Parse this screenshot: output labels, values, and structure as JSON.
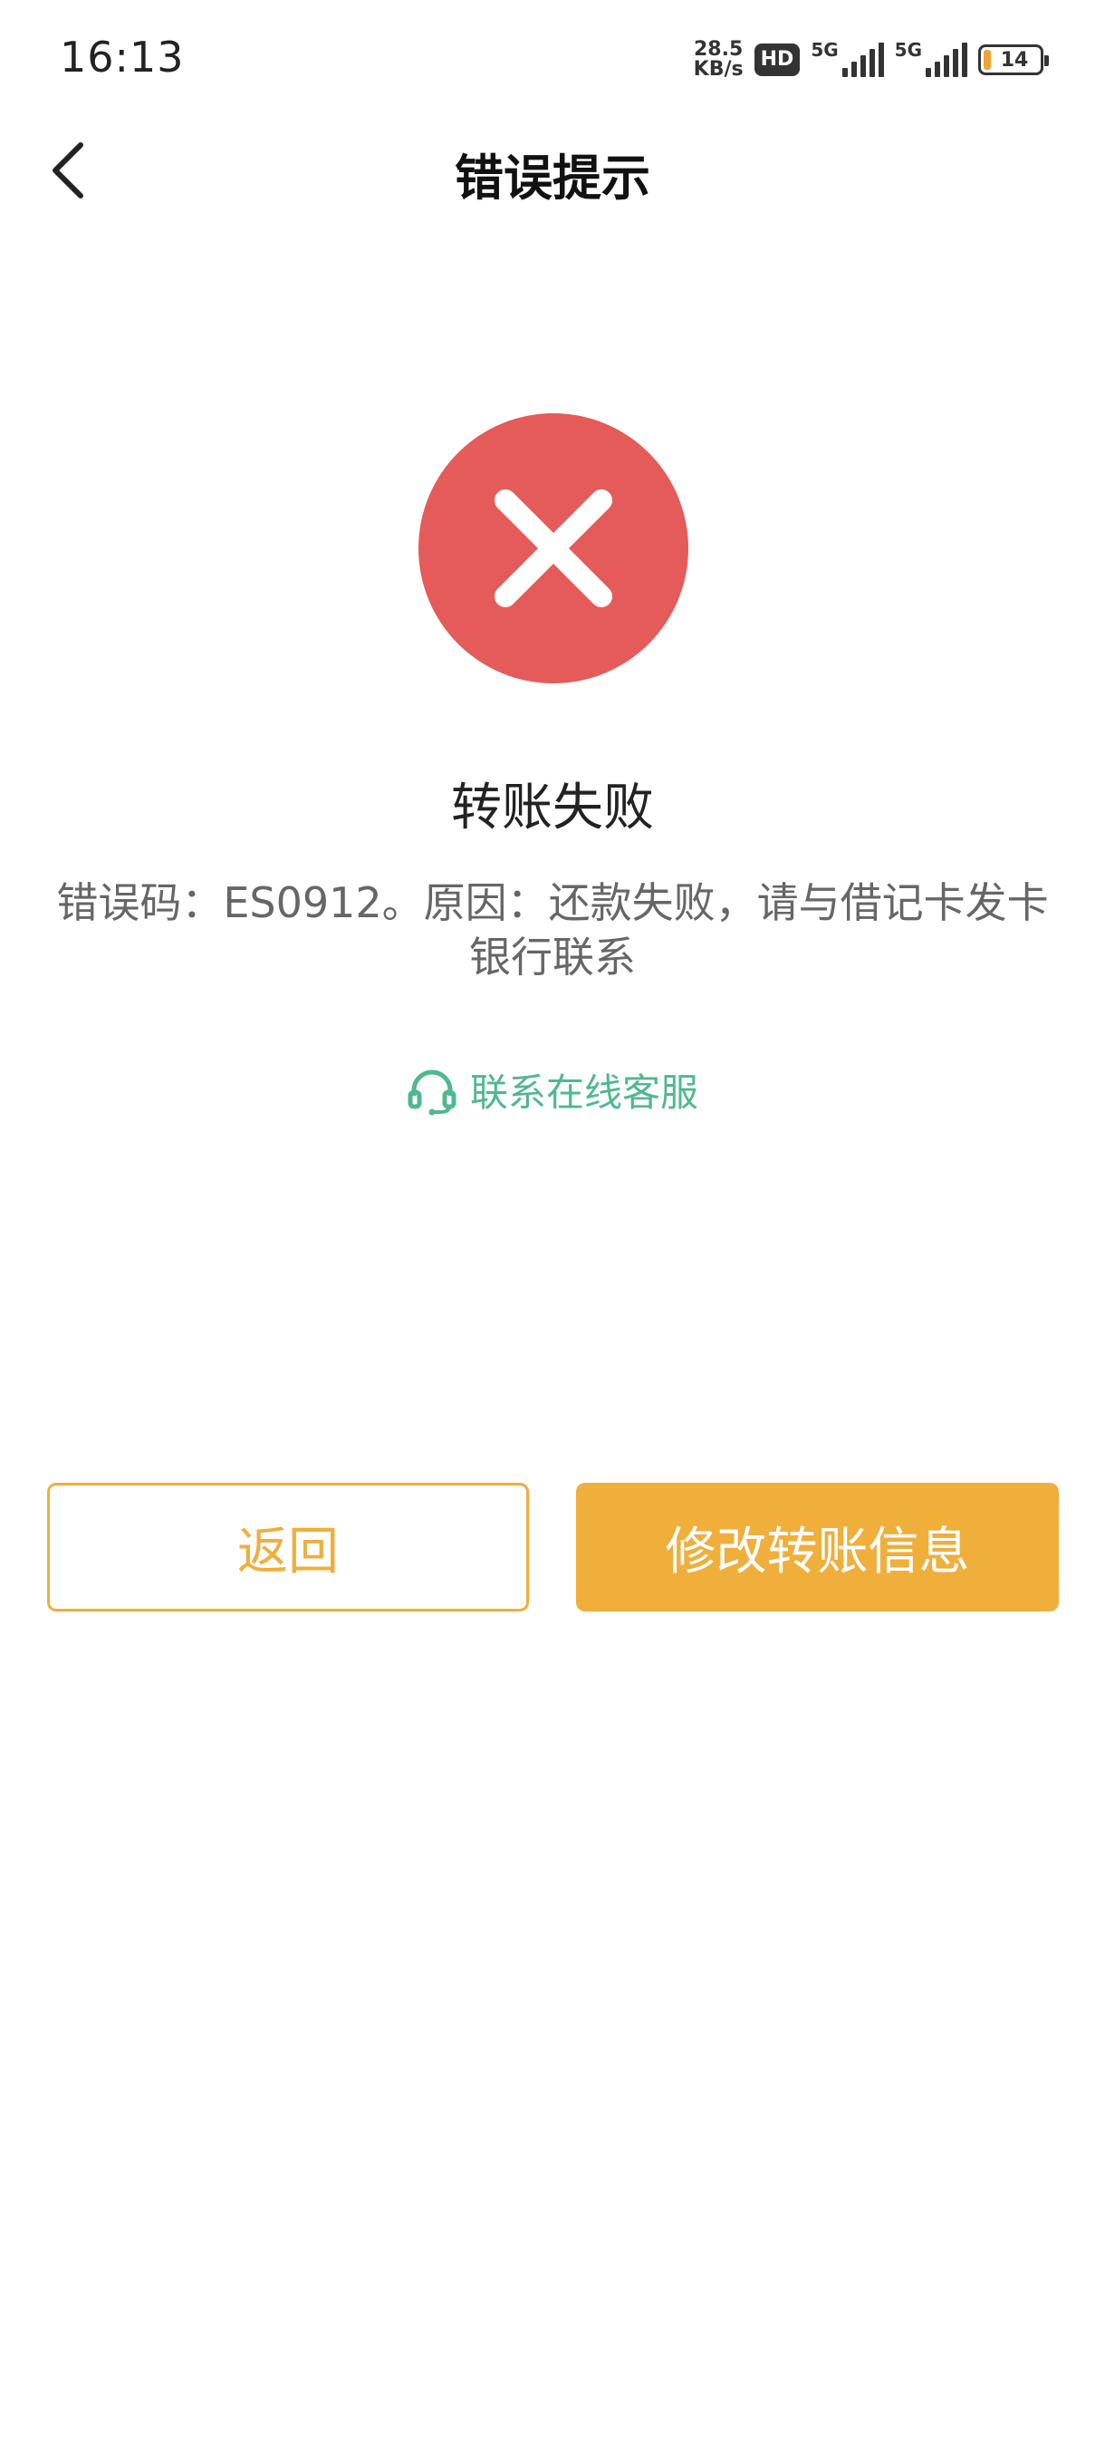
{
  "status_bar": {
    "time": "16:13",
    "net_speed_value": "28.5",
    "net_speed_unit": "KB/s",
    "hd_label": "HD",
    "signal1_label": "5G",
    "signal2_label": "5G",
    "battery_level": "14",
    "battery_color": "#f0a436"
  },
  "nav": {
    "title": "错误提示",
    "back_icon": "chevron-left-icon"
  },
  "result": {
    "icon": "error-x-icon",
    "icon_color": "#e45b59",
    "title": "转账失败",
    "message": "错误码：ES0912。原因：还款失败，请与借记卡发卡银行联系"
  },
  "service": {
    "icon": "headset-icon",
    "label": "联系在线客服",
    "color": "#4fb98e"
  },
  "buttons": {
    "back_label": "返回",
    "modify_label": "修改转账信息",
    "accent_color": "#f0ae3b"
  }
}
